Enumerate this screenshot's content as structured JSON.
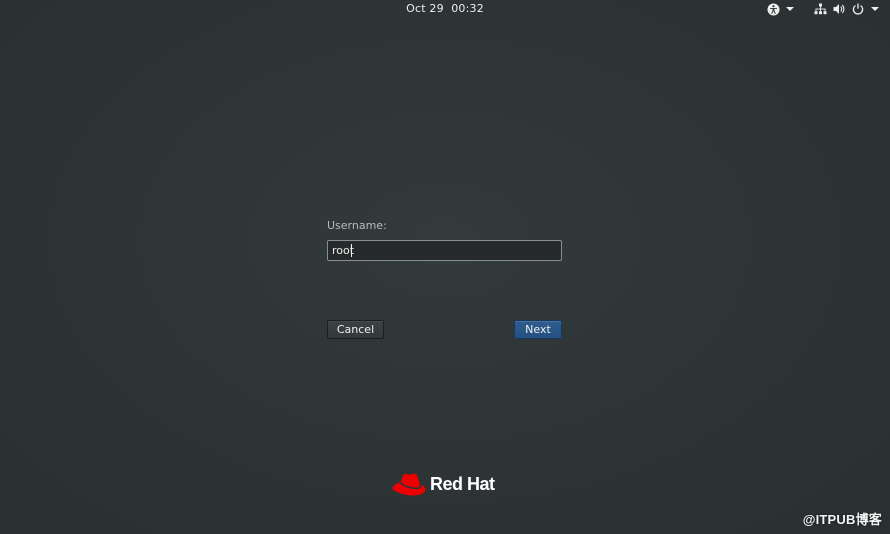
{
  "topbar": {
    "clock": "Oct 29  00:32",
    "accessibility_icon": "accessibility-icon",
    "network_icon": "network-wired-icon",
    "volume_icon": "volume-icon",
    "power_icon": "power-icon"
  },
  "login": {
    "username_label": "Username:",
    "username_value": "root",
    "cancel_label": "Cancel",
    "next_label": "Next"
  },
  "branding": {
    "logo_text": "Red Hat"
  },
  "watermark": {
    "text": "@ITPUB博客"
  },
  "colors": {
    "background": "#2e3436",
    "next_button": "#2a5788",
    "logo_red": "#ee0000",
    "text": "#eeeeec"
  }
}
